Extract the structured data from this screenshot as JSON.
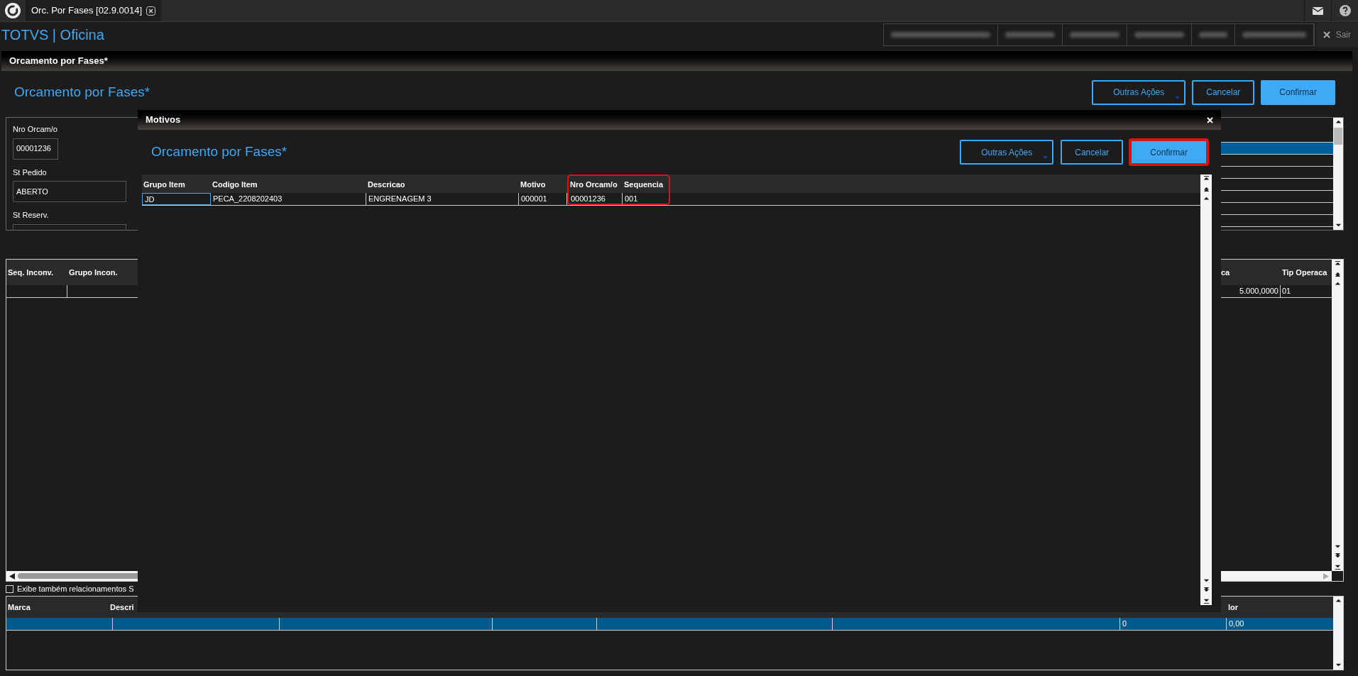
{
  "app_tab": {
    "label": "Orc. Por Fases [02.9.0014]",
    "selected": true
  },
  "header": {
    "brand": "TOTVS | Oficina",
    "exit": "Sair"
  },
  "panel": {
    "title": "Orcamento por Fases*",
    "heading": "Orcamento por Fases*",
    "buttons": [
      {
        "label": "Outras Ações",
        "kind": "menu"
      },
      {
        "label": "Cancelar",
        "kind": "outline"
      },
      {
        "label": "Confirmar",
        "kind": "primary"
      }
    ]
  },
  "form": {
    "fields": [
      {
        "label": "Nro Orcam/o",
        "value": "00001236"
      },
      {
        "label": "St Pedido",
        "value": "ABERTO"
      },
      {
        "label": "St Reserv."
      }
    ]
  },
  "side_list": {
    "rows": [
      {
        "selected": false
      },
      {
        "selected": true
      },
      {
        "selected": false
      },
      {
        "selected": false
      },
      {
        "selected": false
      },
      {
        "selected": false
      },
      {
        "selected": false
      },
      {
        "selected": false
      }
    ]
  },
  "inconsistencies_grid": {
    "columns": [
      "Seq. Inconv.",
      "Grupo Incon.",
      "ca",
      "Tip Operaca"
    ],
    "rows": [
      {
        "column_3": "5.000,0000",
        "column_4": "01"
      }
    ]
  },
  "related_checkbox": {
    "label": "Exibe também relacionamentos S",
    "checked": false
  },
  "brands_grid": {
    "columns": [
      "Marca",
      "Descri",
      "lor"
    ],
    "rows": [
      {
        "selected": true,
        "column_6": "0",
        "column_7": "0,00"
      }
    ]
  },
  "modal": {
    "title": "Motivos",
    "heading": "Orcamento por Fases*",
    "buttons": [
      {
        "label": "Outras Ações",
        "kind": "menu",
        "highlighted": false
      },
      {
        "label": "Cancelar",
        "kind": "outline",
        "highlighted": false
      },
      {
        "label": "Confirmar",
        "kind": "primary",
        "highlighted": true
      }
    ],
    "grid": {
      "columns": [
        {
          "label": "Grupo Item",
          "highlighted": false
        },
        {
          "label": "Codigo Item",
          "highlighted": false
        },
        {
          "label": "Descricao",
          "highlighted": false
        },
        {
          "label": "Motivo",
          "highlighted": false
        },
        {
          "label": "Nro Orcam/o",
          "highlighted": true
        },
        {
          "label": "Sequencia",
          "highlighted": true
        }
      ],
      "rows": [
        {
          "cells": [
            {
              "text": "JD",
              "focused": true
            },
            {
              "text": "PECA_2208202403",
              "focused": false
            },
            {
              "text": "ENGRENAGEM 3",
              "focused": false
            },
            {
              "text": "000001",
              "focused": false
            },
            {
              "text": "00001236",
              "focused": false
            },
            {
              "text": "001",
              "focused": false
            }
          ]
        }
      ]
    }
  }
}
